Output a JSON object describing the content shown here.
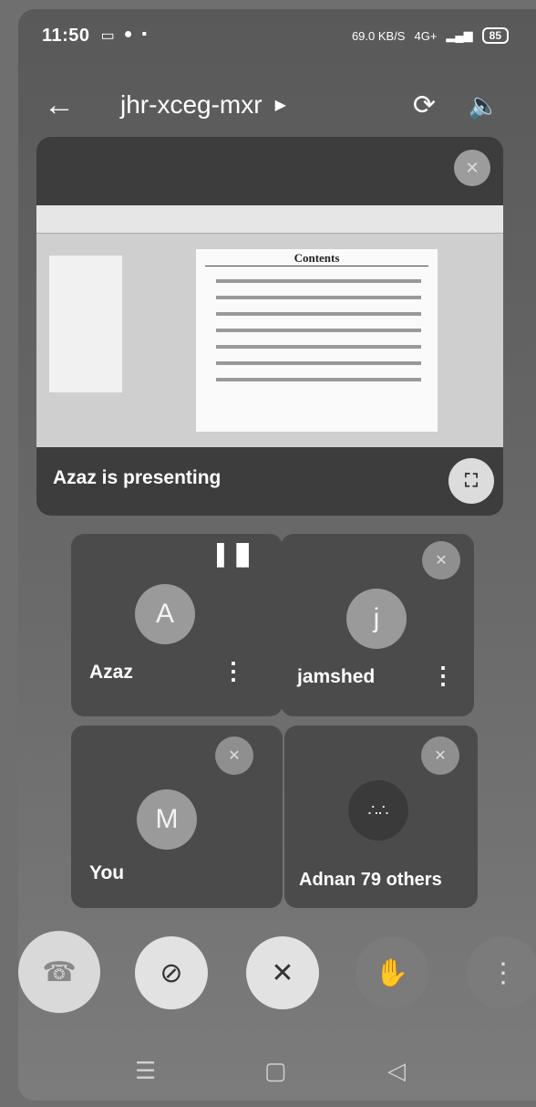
{
  "status_bar": {
    "time": "11:50",
    "net_speed": "69.0 KB/S",
    "network": "4G+",
    "battery": "85"
  },
  "header": {
    "meeting_code": "jhr-xceg-mxr"
  },
  "presentation": {
    "label": "Azaz is presenting",
    "slide_title": "Contents"
  },
  "participants": [
    {
      "initial": "A",
      "name": "Azaz"
    },
    {
      "initial": "j",
      "name": "jamshed"
    },
    {
      "initial": "M",
      "name": "You"
    },
    {
      "name": "Adnan",
      "others": "79 others"
    }
  ],
  "colors": {
    "end_call": "#d9d9d9",
    "tile": "#4b4b4b",
    "screen": "#5f5f5f"
  }
}
